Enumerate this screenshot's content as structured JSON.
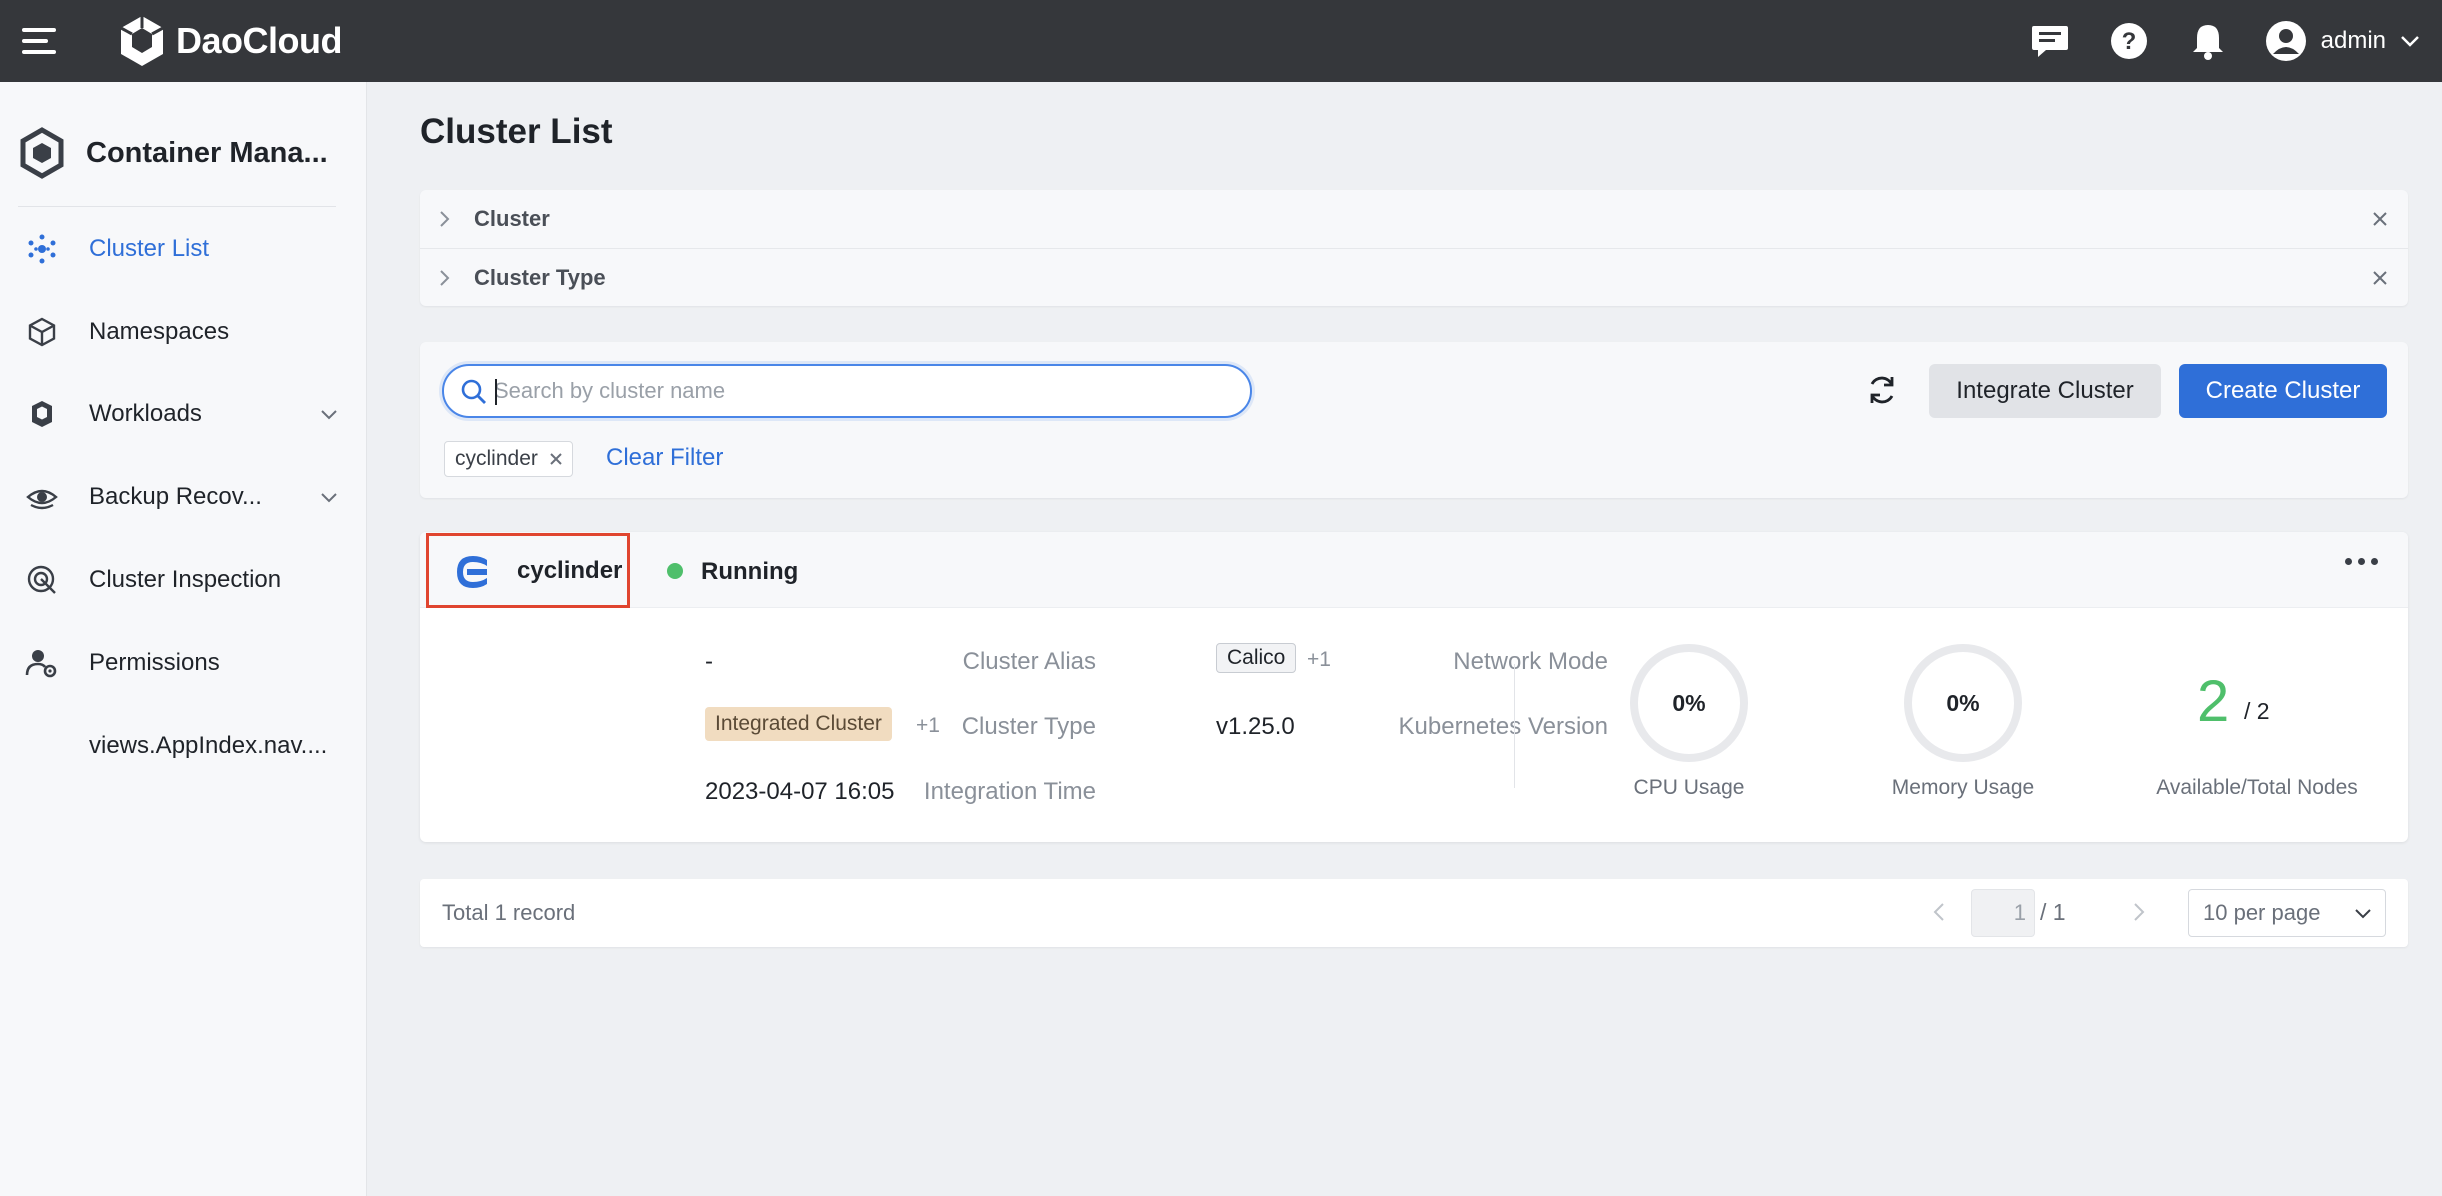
{
  "topbar": {
    "brand": "DaoCloud",
    "user": "admin",
    "icons": [
      "menu-icon",
      "message-icon",
      "help-icon",
      "bell-icon",
      "user-avatar-icon",
      "chevron-down-icon"
    ]
  },
  "sidebar": {
    "title": "Container Mana...",
    "items": [
      {
        "label": "Cluster List",
        "icon": "cluster-list-icon",
        "active": true
      },
      {
        "label": "Namespaces",
        "icon": "cube-icon"
      },
      {
        "label": "Workloads",
        "icon": "workloads-icon",
        "expandable": true
      },
      {
        "label": "Backup Recov...",
        "icon": "backup-icon",
        "expandable": true
      },
      {
        "label": "Cluster Inspection",
        "icon": "inspection-icon"
      },
      {
        "label": "Permissions",
        "icon": "user-gear-icon"
      },
      {
        "label": "views.AppIndex.nav...."
      }
    ]
  },
  "main": {
    "title": "Cluster List",
    "filters": [
      {
        "label": "Cluster"
      },
      {
        "label": "Cluster Type"
      }
    ],
    "search": {
      "placeholder": "Search by cluster name",
      "value": ""
    },
    "buttons": {
      "integrate": "Integrate Cluster",
      "create": "Create Cluster"
    },
    "active_filter_tag": "cyclinder",
    "clear_filter": "Clear Filter"
  },
  "cluster": {
    "name": "cyclinder",
    "status": "Running",
    "status_color": "#4fbf6b",
    "alias_label": "Cluster Alias",
    "alias_value": "-",
    "type_label": "Cluster Type",
    "type_value": "Integrated Cluster",
    "type_more": "+1",
    "time_label": "Integration Time",
    "time_value": "2023-04-07 16:05",
    "network_label": "Network Mode",
    "network_value": "Calico",
    "network_more": "+1",
    "k8s_label": "Kubernetes Version",
    "k8s_value": "v1.25.0",
    "cpu_value": "0%",
    "cpu_label": "CPU Usage",
    "mem_value": "0%",
    "mem_label": "Memory Usage",
    "nodes_available": "2",
    "nodes_total": "/ 2",
    "nodes_label": "Available/Total Nodes"
  },
  "pagination": {
    "total": "Total 1 record",
    "current_page": "1",
    "of_pages": "/ 1",
    "per_page": "10 per page"
  },
  "colors": {
    "accent": "#2f6fd8",
    "topbar": "#35373b",
    "highlight_box": "#e0452f"
  }
}
